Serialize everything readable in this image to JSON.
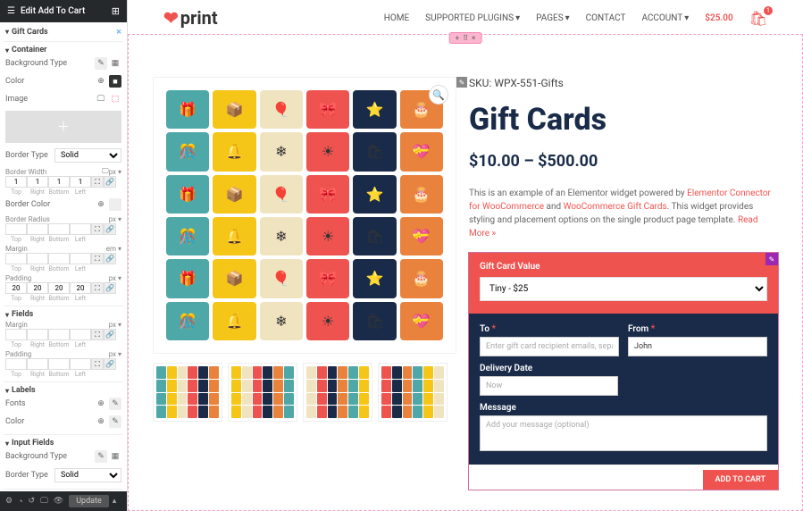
{
  "edit_title": "Edit Add To Cart",
  "sections": {
    "gift_cards": "Gift Cards",
    "container": "Container",
    "fields": "Fields",
    "labels": "Labels",
    "input_fields": "Input Fields"
  },
  "ctrls": {
    "bg_type": "Background Type",
    "color": "Color",
    "image": "Image",
    "border_type": "Border Type",
    "border_width": "Border Width",
    "border_color": "Border Color",
    "border_radius": "Border Radius",
    "margin": "Margin",
    "padding": "Padding",
    "fonts": "Fonts",
    "solid": "Solid",
    "px": "px",
    "em": "em"
  },
  "pad_vals": {
    "t": "20",
    "r": "20",
    "b": "20",
    "l": "20"
  },
  "one_vals": {
    "t": "1",
    "r": "1",
    "b": "1",
    "l": "1"
  },
  "dir_labels": {
    "top": "Top",
    "right": "Right",
    "bottom": "Bottom",
    "left": "Left"
  },
  "update_btn": "Update",
  "logo_text": "print",
  "nav": {
    "home": "HOME",
    "plugins": "SUPPORTED PLUGINS",
    "pages": "PAGES",
    "contact": "CONTACT",
    "account": "ACCOUNT",
    "price": "$25.00",
    "badge": "1"
  },
  "product": {
    "sku": "SKU: WPX-551-Gifts",
    "title": "Gift Cards",
    "range": "$10.00 – $500.00",
    "desc_pre": "This is an example of an Elementor widget powered by ",
    "link1": "Elementor Connector for WooCommerce",
    "and": " and ",
    "link2": "WooCommerce Gift Cards",
    "desc_post": ". This widget provides styling and placement options on the single product page template. ",
    "readmore": "Read More »"
  },
  "form": {
    "gc_value": "Gift Card Value",
    "gc_option": "Tiny - $25",
    "to": "To",
    "from": "From",
    "delivery": "Delivery Date",
    "message": "Message",
    "to_ph": "Enter gift card recipient emails, separ",
    "from_val": "John",
    "date_ph": "Now",
    "msg_ph": "Add your message (optional)",
    "addcart": "ADD TO CART",
    "req": "*"
  },
  "colors": {
    "red": "#ef5350",
    "navy": "#1a2b4a",
    "yellow": "#f5c518",
    "teal": "#4fa8a8",
    "cream": "#f0e4c0",
    "orange": "#e8823c"
  }
}
